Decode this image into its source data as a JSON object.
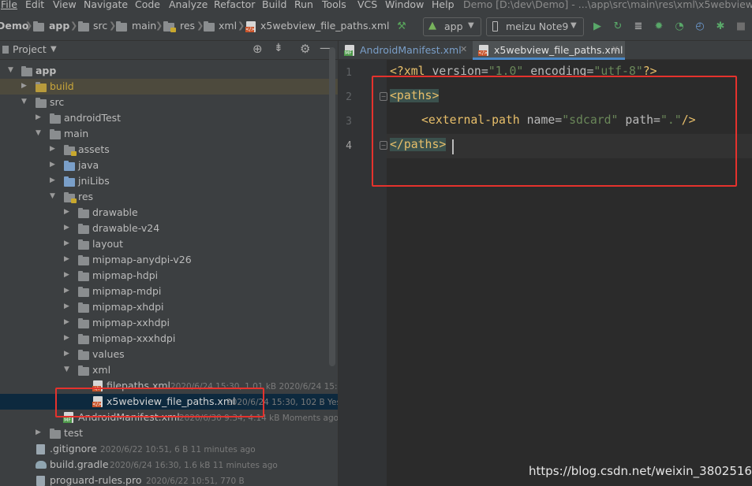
{
  "menu": [
    "File",
    "Edit",
    "View",
    "Navigate",
    "Code",
    "Analyze",
    "Refactor",
    "Build",
    "Run",
    "Tools",
    "VCS",
    "Window",
    "Help"
  ],
  "window_title": "Demo [D:\\dev\\Demo] - ...\\app\\src\\main\\res\\xml\\x5webview_file",
  "breadcrumbs": [
    "Demo",
    "app",
    "src",
    "main",
    "res",
    "xml",
    "x5webview_file_paths.xml"
  ],
  "toolbar": {
    "config": "app",
    "device": "meizu Note9"
  },
  "project_panel": {
    "title": "Project"
  },
  "tree": [
    {
      "label": "app",
      "meta": ""
    },
    {
      "label": "build",
      "meta": ""
    },
    {
      "label": "src",
      "meta": ""
    },
    {
      "label": "androidTest",
      "meta": ""
    },
    {
      "label": "main",
      "meta": ""
    },
    {
      "label": "assets",
      "meta": ""
    },
    {
      "label": "java",
      "meta": ""
    },
    {
      "label": "jniLibs",
      "meta": ""
    },
    {
      "label": "res",
      "meta": ""
    },
    {
      "label": "drawable",
      "meta": ""
    },
    {
      "label": "drawable-v24",
      "meta": ""
    },
    {
      "label": "layout",
      "meta": ""
    },
    {
      "label": "mipmap-anydpi-v26",
      "meta": ""
    },
    {
      "label": "mipmap-hdpi",
      "meta": ""
    },
    {
      "label": "mipmap-mdpi",
      "meta": ""
    },
    {
      "label": "mipmap-xhdpi",
      "meta": ""
    },
    {
      "label": "mipmap-xxhdpi",
      "meta": ""
    },
    {
      "label": "mipmap-xxxhdpi",
      "meta": ""
    },
    {
      "label": "values",
      "meta": ""
    },
    {
      "label": "xml",
      "meta": ""
    },
    {
      "label": "filepaths.xml",
      "meta": "2020/6/24 15:30, 1.01 kB 2020/6/24 15:31"
    },
    {
      "label": "x5webview_file_paths.xml",
      "meta": "2020/6/24 15:30, 102 B Yest"
    },
    {
      "label": "AndroidManifest.xml",
      "meta": "2020/6/30 9:34, 4.14 kB Moments ago"
    },
    {
      "label": "test",
      "meta": ""
    },
    {
      "label": ".gitignore",
      "meta": "2020/6/22 10:51, 6 B 11 minutes ago"
    },
    {
      "label": "build.gradle",
      "meta": "2020/6/24 16:30, 1.6 kB 11 minutes ago"
    },
    {
      "label": "proguard-rules.pro",
      "meta": "2020/6/22 10:51, 770 B"
    }
  ],
  "tabs": [
    {
      "label": "AndroidManifest.xml",
      "active": false
    },
    {
      "label": "x5webview_file_paths.xml",
      "active": true
    }
  ],
  "editor": {
    "line_numbers": [
      "1",
      "2",
      "3",
      "4"
    ],
    "decl": {
      "open": "<?xml ",
      "a1": "version",
      "eq1": "=",
      "v1": "\"1.0\"",
      "sp": " ",
      "a2": "encoding",
      "eq2": "=",
      "v2": "\"utf-8\"",
      "close": "?>"
    },
    "l2": "<paths>",
    "l3": {
      "open": "<external-path ",
      "a1": "name",
      "eq1": "=",
      "v1": "\"sdcard\"",
      "sp": " ",
      "a2": "path",
      "eq2": "=",
      "v2": "\".\"",
      "close": "/>"
    },
    "l4": "</paths>"
  },
  "watermark": "https://blog.csdn.net/weixin_38025168",
  "colors": {
    "highlight_box": "#e5322d",
    "tag": "#e8bf6a",
    "value": "#6a8759",
    "selection": "#0d293e"
  }
}
